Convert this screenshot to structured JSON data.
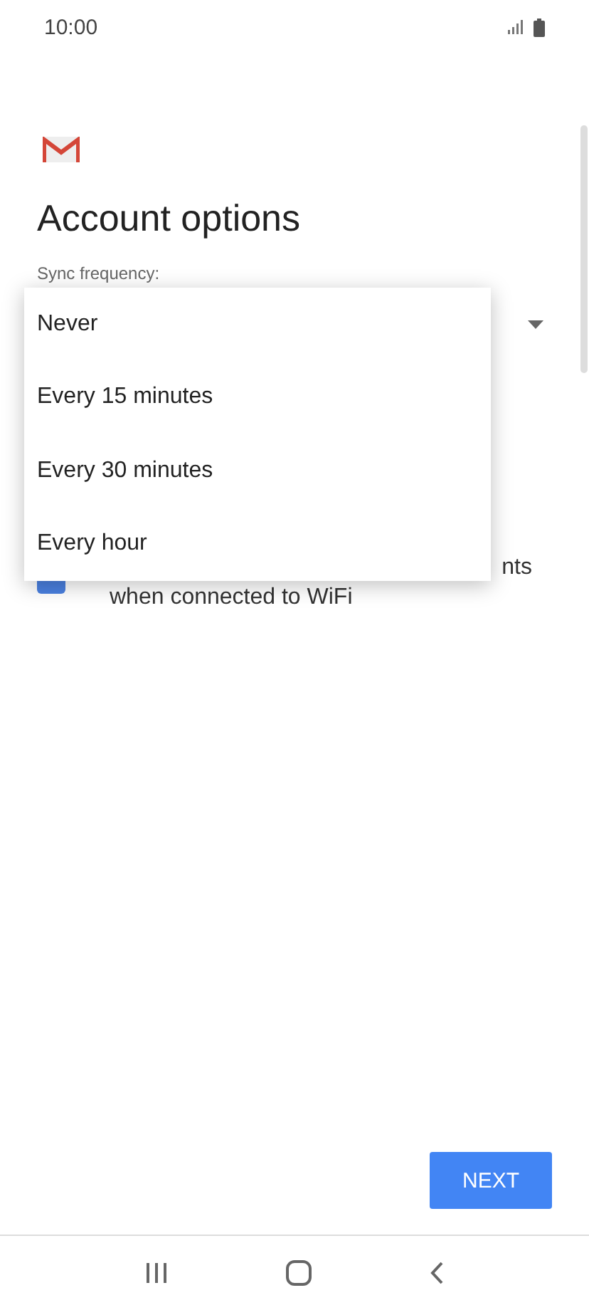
{
  "status_bar": {
    "time": "10:00"
  },
  "title": "Account options",
  "sync": {
    "label": "Sync frequency:"
  },
  "menu": {
    "items": [
      {
        "label": "Never"
      },
      {
        "label": "Every 15 minutes"
      },
      {
        "label": "Every 30 minutes"
      },
      {
        "label": "Every hour"
      }
    ]
  },
  "attachments": {
    "checked": true,
    "label_end": "nts",
    "label_line2": "when connected to WiFi"
  },
  "next_button": "NEXT"
}
